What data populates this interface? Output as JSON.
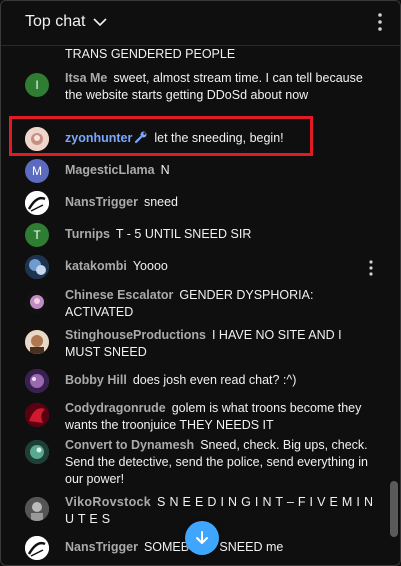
{
  "header": {
    "title": "Top chat",
    "dropdown_icon": "chevron-down-icon",
    "menu_icon": "more-vert-icon"
  },
  "chat": {
    "partial_top_text": "TRANS GENDERED PEOPLE",
    "messages": [
      {
        "author": "Itsa Me",
        "text": "sweet, almost stream time. I can tell because the website starts getting DDoSd about now",
        "avatar_letter": "I",
        "avatar_color": "#2e7d32"
      },
      {
        "author": "zyonhunter",
        "text": "let the sneeding, begin!",
        "owner": true,
        "badge_icon": "wrench-icon",
        "avatar_color": "#d9b7a8"
      },
      {
        "author": "MagesticLlama",
        "text": "N",
        "avatar_letter": "M",
        "avatar_color": "#5c6bc0"
      },
      {
        "author": "NansTrigger",
        "text": "sneed",
        "avatar_color": "#ffffff"
      },
      {
        "author": "Turnips",
        "text": "T - 5 UNTIL SNEED SIR",
        "avatar_letter": "T",
        "avatar_color": "#2e7d32"
      },
      {
        "author": "katakombi",
        "text": "Yoooo",
        "avatar_color": "#3b5a80"
      },
      {
        "author": "Chinese Escalator",
        "text": "GENDER DYSPHORIA: ACTIVATED",
        "avatar_color": "#c08ac4"
      },
      {
        "author": "StinghouseProductions",
        "text": "I HAVE NO SITE AND I MUST SNEED",
        "avatar_color": "#b07850"
      },
      {
        "author": "Bobby Hill",
        "text": "does josh even read chat? :^)",
        "avatar_color": "#7a4a8a"
      },
      {
        "author": "Codydragonrude",
        "text": "golem is what troons become they wants the troonjuice THEY NEEDS IT",
        "avatar_color": "#b3122a"
      },
      {
        "author": "Convert to Dynamesh",
        "text": "Sneed, check. Big ups, check. Send the detective, send the police, send everything in our power!",
        "avatar_color": "#3a7a6a"
      },
      {
        "author": "VikoRovstock",
        "text": "S N E E D I N G I N T – F I V E M I N U T E S",
        "avatar_color": "#888888"
      },
      {
        "author": "NansTrigger",
        "text": "SOMEBODY SNEED me",
        "avatar_color": "#ffffff"
      }
    ]
  },
  "controls": {
    "row_menu_icon": "more-vert-icon",
    "scroll_down_icon": "arrow-down-icon"
  },
  "colors": {
    "background": "#0f0f0f",
    "author_gray": "#aaaaaa",
    "owner_blue": "#7aa7ff",
    "highlight_red": "#e01b24",
    "accent_blue": "#3ea6ff"
  }
}
